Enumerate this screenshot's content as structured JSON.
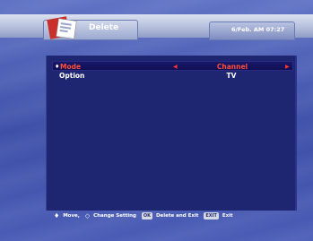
{
  "header": {
    "title": "Delete",
    "datetime": "6/Feb. AM 07:27",
    "icon": "menu-book-icon"
  },
  "menu": {
    "rows": [
      {
        "label": "Mode",
        "value": "Channel",
        "selected": true
      },
      {
        "label": "Option",
        "value": "TV",
        "selected": false
      }
    ]
  },
  "footer": {
    "move": "Move,",
    "change": "Change Setting",
    "ok_key": "OK",
    "delete_exit": "Delete and Exit",
    "exit_key": "EXIT",
    "exit": "Exit"
  },
  "colors": {
    "panel": "#1e2571",
    "highlight_text": "#ff4c38",
    "arrow": "#ff3333",
    "header_bar": "#b6c0dd"
  }
}
